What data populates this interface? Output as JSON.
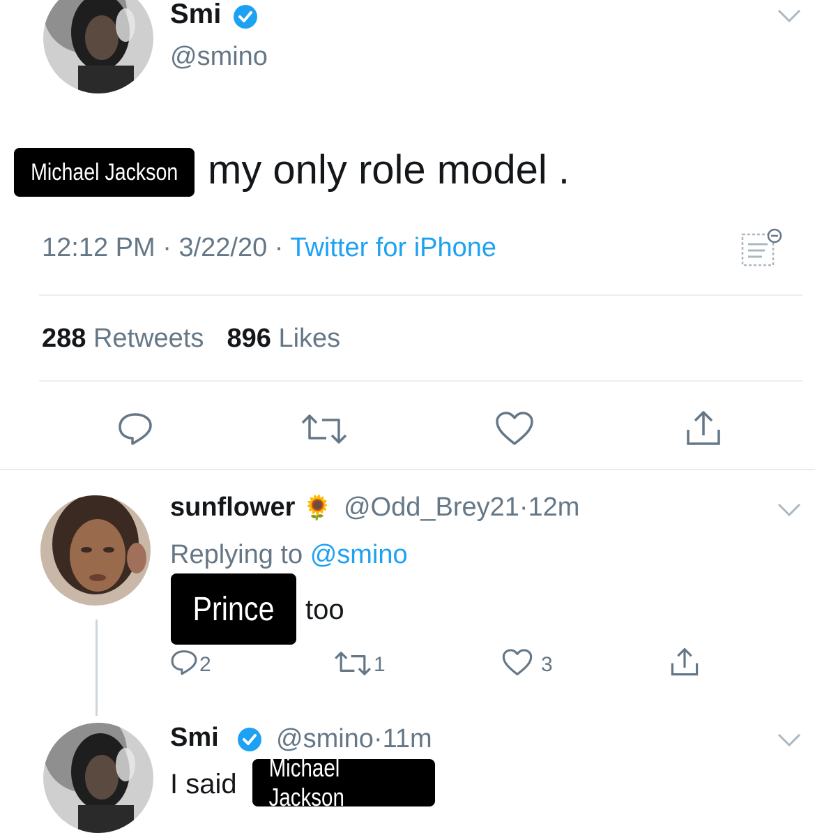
{
  "tweet": {
    "name": "Smi",
    "handle": "@smino",
    "text": "my only role model .",
    "overlay_label": "Michael Jackson",
    "time": "12:12 PM",
    "date": "3/22/20",
    "source": "Twitter for iPhone",
    "dot": "·",
    "retweets_count": "288",
    "retweets_label": "Retweets",
    "likes_count": "896",
    "likes_label": "Likes"
  },
  "reply1": {
    "name": "sunflower",
    "emoji": "🌻",
    "handle": "@Odd_Brey21",
    "dot": "·",
    "time": "12m",
    "replying_label": "Replying to",
    "replying_handle": "@smino",
    "overlay_label": "Prince",
    "text": "too",
    "reply_count": "2",
    "retweet_count": "1",
    "like_count": "3"
  },
  "reply2": {
    "name": "Smi",
    "handle": "@smino",
    "dot": "·",
    "time": "11m",
    "text": "I said",
    "overlay_label": "Michael Jackson"
  },
  "colors": {
    "verified": "#1da1f2",
    "link": "#1da1f2",
    "muted": "#657786",
    "overlay": "#000000"
  }
}
